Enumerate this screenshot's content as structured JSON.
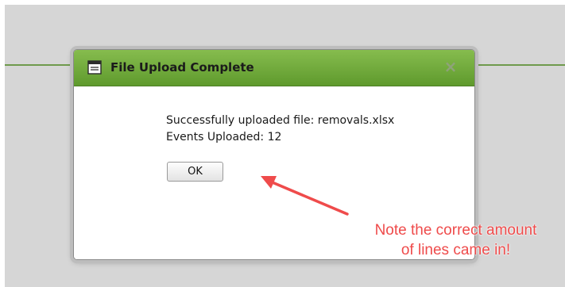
{
  "dialog": {
    "title": "File Upload Complete",
    "close_label": "×",
    "message_line1": "Successfully uploaded file: removals.xlsx",
    "message_line2": "Events Uploaded: 12",
    "ok_label": "OK"
  },
  "annotation": {
    "line1": "Note the correct amount",
    "line2": "of lines came in!",
    "color": "#ef4b4b"
  },
  "colors": {
    "titlebar_green": "#6fa83a",
    "background": "#d6d6d6"
  },
  "icons": [
    "window-icon",
    "close-icon",
    "arrow-icon"
  ]
}
